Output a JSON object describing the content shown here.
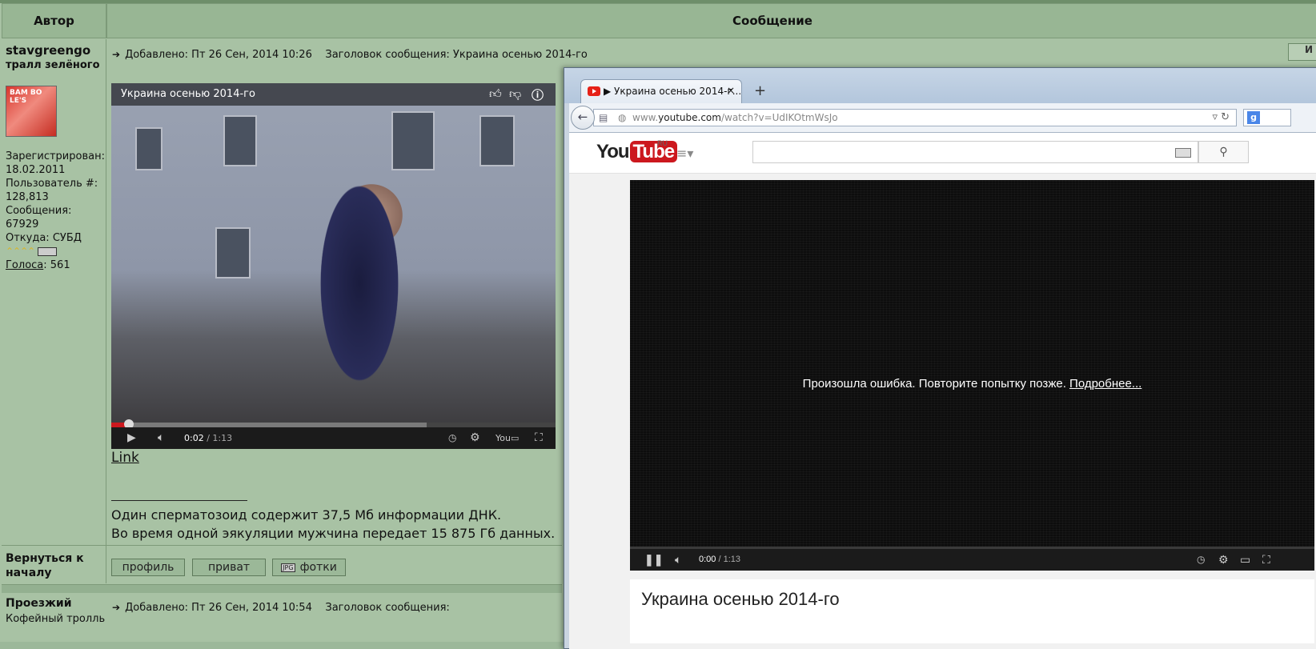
{
  "forum": {
    "header": {
      "author_col": "Автор",
      "message_col": "Сообщение"
    },
    "post1": {
      "username": "stavgreengo",
      "user_title": "тралл зелёного",
      "avatar_text": "BAM BO LE'S",
      "info": {
        "registered_label": "Зарегистрирован:",
        "registered_value": "18.02.2011",
        "user_num_label": "Пользователь #:",
        "user_num_value": "128,813",
        "messages_label": "Сообщения:",
        "messages_value": "67929",
        "from_label": "Откуда:",
        "from_value": "СУБД",
        "stars": "⌃⌃⌃⌃",
        "votes_link": "Голоса",
        "votes_value": ": 561"
      },
      "meta": "Добавлено: Пт 26 Сен, 2014 10:26    Заголовок сообщения: Украина осенью 2014-го",
      "quote_button": "И",
      "video": {
        "title": "Украина осенью 2014-го",
        "time_current": "0:02",
        "time_total": "/ 1:13",
        "progress": 0.04,
        "buffered": 0.71
      },
      "link_text": "Link",
      "signature": [
        "Один сперматозоид содержит 37,5 Мб информации ДНК.",
        "Во время одной эякуляции мужчина передает 15 875 Гб данных."
      ],
      "back_to_top": "Вернуться к началу",
      "buttons": {
        "profile": "профиль",
        "private": "приват",
        "photos": "фотки",
        "photos_badge": "JPG"
      }
    },
    "post2": {
      "username": "Проезжий",
      "user_title": "Кофейный тролль",
      "meta": "Добавлено: Пт 26 Сен, 2014 10:54    Заголовок сообщения:"
    }
  },
  "browser": {
    "tab_title": "▶ Украина осенью 2014-г...",
    "tab_close": "×",
    "new_tab": "+",
    "url_prefix": "www.",
    "url_domain": "youtube.com",
    "url_path": "/watch?v=UdIKOtmWsJo",
    "search_engine_badge": "g",
    "youtube": {
      "logo_you": "You",
      "logo_tube": "Tube",
      "logo_region": "RU",
      "error_text": "Произошла ошибка. Повторите попытку позже.",
      "error_link": "Подробнее...",
      "time_current": "0:00",
      "time_total": "/ 1:13",
      "video_title": "Украина осенью 2014-го"
    }
  }
}
